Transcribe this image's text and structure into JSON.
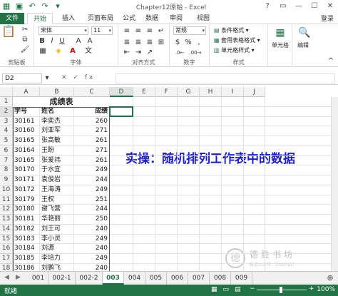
{
  "window": {
    "title": "Chapter12原始 - Excel",
    "controls": [
      "?",
      "▭",
      "—",
      "☐",
      "✕"
    ]
  },
  "ribbon_tabs": [
    "文件",
    "开始",
    "插入",
    "页面布局",
    "公式",
    "数据",
    "审阅",
    "视图"
  ],
  "active_tab": "开始",
  "signin": "登录",
  "ribbon": {
    "clipboard_label": "剪贴板",
    "font_label": "字体",
    "font_name": "宋体",
    "font_size": "11",
    "align_label": "对齐方式",
    "number_format": "常规",
    "number_label": "数字",
    "styles_label": "样式",
    "styles_items": [
      "条件格式",
      "套用表格格式",
      "单元格样式"
    ],
    "cells_label": "单元格",
    "edit_label": "编辑"
  },
  "formula_bar": {
    "name_box": "D2",
    "fx": "fx",
    "value": ""
  },
  "columns": [
    "A",
    "B",
    "C",
    "D",
    "E",
    "F",
    "G",
    "H",
    "I",
    "J"
  ],
  "selected_column": "D",
  "rows": [
    "1",
    "2",
    "3",
    "4",
    "5",
    "6",
    "7",
    "8",
    "9",
    "10",
    "11",
    "12",
    "13",
    "14",
    "15",
    "16",
    "17",
    "18"
  ],
  "table": {
    "title": "成绩表",
    "headers": [
      "学号",
      "姓名",
      "成绩"
    ],
    "records": [
      [
        "30161",
        "李奕杰",
        "260"
      ],
      [
        "30160",
        "刘亚军",
        "271"
      ],
      [
        "30165",
        "张高敏",
        "261"
      ],
      [
        "30164",
        "王盼",
        "271"
      ],
      [
        "30165",
        "张爱祎",
        "261"
      ],
      [
        "30170",
        "于水宜",
        "249"
      ],
      [
        "30171",
        "袁俊岩",
        "244"
      ],
      [
        "30172",
        "王海涛",
        "249"
      ],
      [
        "30179",
        "王权",
        "251"
      ],
      [
        "30180",
        "谢飞营",
        "244"
      ],
      [
        "30181",
        "华艳丽",
        "250"
      ],
      [
        "30182",
        "刘王可",
        "240"
      ],
      [
        "30183",
        "李小灵",
        "249"
      ],
      [
        "30184",
        "刘源",
        "240"
      ],
      [
        "30185",
        "李培力",
        "249"
      ],
      [
        "30186",
        "刘鹏飞",
        "240"
      ]
    ]
  },
  "banner": "实操：随机排列工作表中的数据",
  "watermark": {
    "logo": "德",
    "text": "德胜书坊",
    "sub": "微信公众号：DSSF007"
  },
  "sheet_nav": [
    "◀",
    "▶"
  ],
  "sheet_tabs": [
    "001",
    "002-1",
    "002-2",
    "003",
    "004",
    "005",
    "006",
    "007",
    "008",
    "009"
  ],
  "active_sheet": "003",
  "status": {
    "ready": "就绪",
    "zoom_minus": "−",
    "zoom_plus": "+",
    "zoom": "100%"
  }
}
